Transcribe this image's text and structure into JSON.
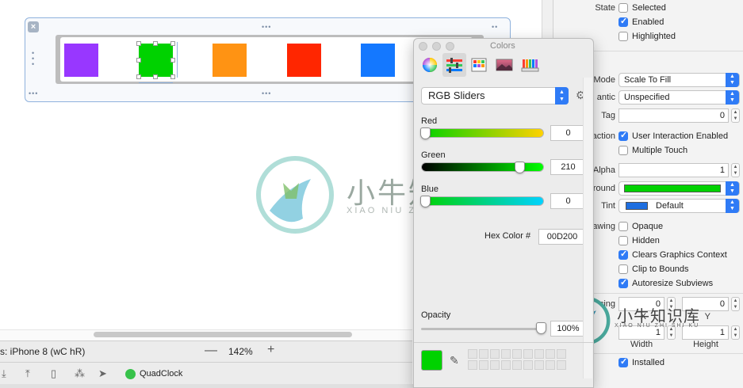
{
  "canvas": {
    "zoom_minus": "—",
    "zoom_value": "142%",
    "zoom_plus": "+",
    "view_as": "s: iPhone 8 (wC hR)",
    "scheme_name": "QuadClock"
  },
  "swatches": {
    "purple": "#9837ff",
    "green": "#00d200",
    "orange": "#ff9313",
    "red": "#ff2600",
    "blue": "#1478ff"
  },
  "watermark": {
    "cn": "小牛知识库",
    "en": "XIAO NIU ZHI SHI KU",
    "small_cn": "小牛知识库",
    "small_en": "XIAO NIU ZHI SHI KU"
  },
  "colors_panel": {
    "title": "Colors",
    "mode": "RGB Sliders",
    "red_label": "Red",
    "red_value": "0",
    "green_label": "Green",
    "green_value": "210",
    "blue_label": "Blue",
    "blue_value": "0",
    "hex_label": "Hex Color #",
    "hex_value": "00D200",
    "opacity_label": "Opacity",
    "opacity_value": "100%",
    "current_color": "#00d200"
  },
  "inspector": {
    "state_label": "State",
    "selected": "Selected",
    "enabled": "Enabled",
    "highlighted": "Highlighted",
    "mode_label": "Mode",
    "mode_value": "Scale To Fill",
    "semantic_label": "antic",
    "semantic_value": "Unspecified",
    "tag_label": "Tag",
    "tag_value": "0",
    "interaction_label": "action",
    "user_interaction": "User Interaction Enabled",
    "multiple_touch": "Multiple Touch",
    "alpha_label": "Alpha",
    "alpha_value": "1",
    "background_label": "round",
    "background_color": "#00d200",
    "tint_label": "Tint",
    "tint_value": "Default",
    "tint_color": "#1f6fe0",
    "drawing_label": "awing",
    "opaque": "Opaque",
    "hidden": "Hidden",
    "clears_graphics": "Clears Graphics Context",
    "clip_to_bounds": "Clip to Bounds",
    "autoresize": "Autoresize Subviews",
    "spacing_label": "cing",
    "stretch_x": "0",
    "stretch_y": "0",
    "x_label": "X",
    "y_label": "Y",
    "stretch_w": "1",
    "stretch_h": "1",
    "width_label": "Width",
    "height_label": "Height",
    "installed": "Installed"
  }
}
